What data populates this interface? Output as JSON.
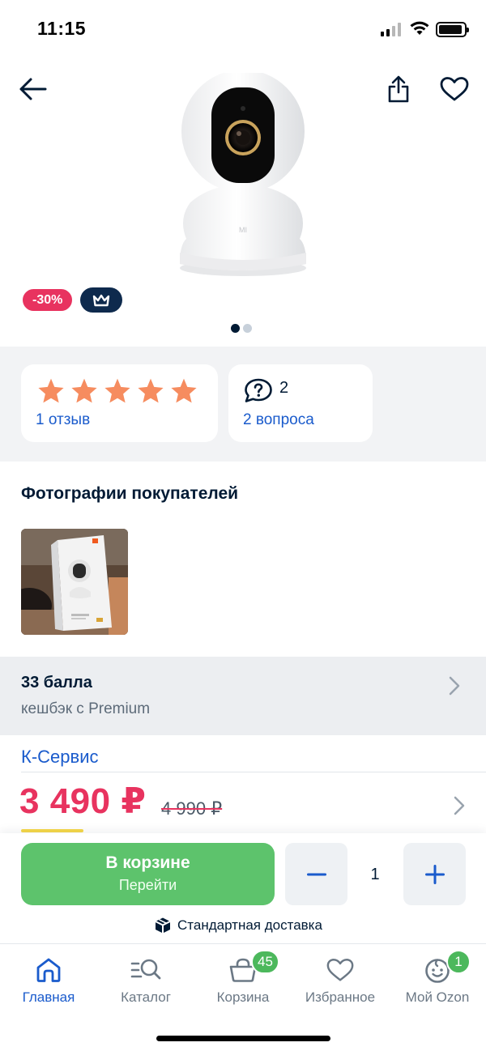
{
  "status_bar": {
    "time": "11:15"
  },
  "product": {
    "discount_badge": "-30%",
    "image_count": 2,
    "active_image": 1
  },
  "rating": {
    "stars": 5,
    "reviews_label": "1 отзыв",
    "questions_count": "2",
    "questions_label": "2 вопроса"
  },
  "customer_photos": {
    "title": "Фотографии покупателей"
  },
  "cashback": {
    "title": "33 балла",
    "subtitle": "кешбэк с Premium"
  },
  "seller": {
    "name": "К-Сервис"
  },
  "price": {
    "current": "3 490 ₽",
    "old": "4 990 ₽"
  },
  "cart": {
    "in_cart_label": "В корзине",
    "go_label": "Перейти",
    "quantity": "1",
    "delivery_label": "Стандартная доставка"
  },
  "tabbar": {
    "home": "Главная",
    "catalog": "Каталог",
    "cart": "Корзина",
    "cart_badge": "45",
    "favorites": "Избранное",
    "profile": "Мой Ozon",
    "profile_badge": "1"
  },
  "colors": {
    "accent_blue": "#1a5bcc",
    "price_red": "#e8335f",
    "cart_green": "#5dc36c",
    "star_orange": "#f68c5f",
    "premium_navy": "#0e2a4d"
  },
  "icons": [
    "back-arrow-icon",
    "share-icon",
    "heart-icon",
    "crown-icon",
    "star-icon",
    "question-bubble-icon",
    "chevron-right-icon",
    "minus-icon",
    "plus-icon",
    "box-icon",
    "home-icon",
    "catalog-search-icon",
    "basket-icon",
    "smiley-icon"
  ]
}
